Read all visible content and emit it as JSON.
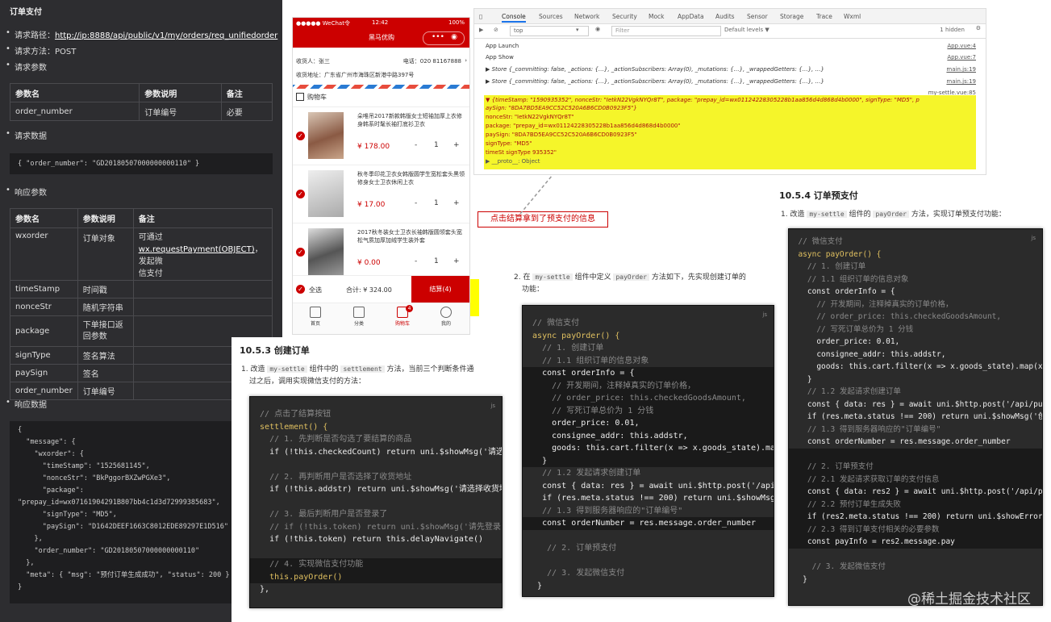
{
  "api": {
    "heading": "订单支付",
    "path_label": "请求路径：",
    "path_url": "http://ip:8888/api/public/v1/my/orders/req_unifiedorder",
    "method": "请求方法：POST",
    "params_label": "请求参数",
    "req_table": {
      "headers": [
        "参数名",
        "参数说明",
        "备注"
      ],
      "rows": [
        [
          "order_number",
          "订单编号",
          "必要"
        ]
      ]
    },
    "req_data_label": "请求数据",
    "req_data_code": "{ \"order_number\": \"GD20180507000000000110\" }",
    "resp_params_label": "响应参数",
    "resp_table": {
      "headers": [
        "参数名",
        "参数说明",
        "备注"
      ],
      "rows": [
        [
          "wxorder",
          "订单对象",
          "可通过"
        ],
        [
          "timeStamp",
          "时间戳",
          ""
        ],
        [
          "nonceStr",
          "随机字符串",
          ""
        ],
        [
          "package",
          "下单接口返",
          ""
        ],
        [
          "signType",
          "签名算法",
          ""
        ],
        [
          "paySign",
          "签名",
          ""
        ],
        [
          "order_number",
          "订单编号",
          ""
        ]
      ],
      "wx_note_link": "wx.requestPayment(OBJECT)",
      "wx_note_tail": "，发起微",
      "wx_note_line3": "信支付",
      "package_line2": "回参数"
    },
    "resp_data_label": "响应数据",
    "resp_code": [
      "{",
      "  \"message\": {",
      "    \"wxorder\": {",
      "      \"timeStamp\": \"1525681145\",",
      "      \"nonceStr\": \"BkPggorBXZwPGXe3\",",
      "      \"package\":",
      "\"prepay_id=wx07161904291B807bb4c1d3d72999385683\",",
      "      \"signType\": \"MD5\",",
      "      \"paySign\": \"D1642DEEF1663C8012EDE89297E1D516\"",
      "    },",
      "    \"order_number\": \"GD20180507000000000110\"",
      "  },",
      "  \"meta\": { \"msg\": \"预付订单生成成功\", \"status\": 200 }",
      "}"
    ]
  },
  "phone": {
    "status_left": "●●●●● WeChat令",
    "status_time": "12:42",
    "status_right": "100%",
    "nav_title": "黑马优购",
    "receiver": "收货人：张三",
    "phone_num": "电话：020 81167888",
    "address": "收货地址：广东省广州市海珠区新港中路397号",
    "cart_title": "购物车",
    "items": [
      {
        "title": "朵唯吊2017新款韩版女士短袖加厚上衣修身韩系时髦长袖打底衫卫衣",
        "price": "¥ 178.00",
        "qty": "1"
      },
      {
        "title": "秋冬季印花卫衣女韩版圆学生宽松套头黑领修身女士卫衣休闲上衣",
        "price": "¥ 17.00",
        "qty": "1"
      },
      {
        "title": "2017秋冬装女士卫衣长袖韩版圆领套头宽松气质加厚加绒学生装外套",
        "price": "¥ 0.00",
        "qty": "1"
      }
    ],
    "select_all": "全选",
    "total": "合计: ¥ 324.00",
    "settle": "结算(4)",
    "tabs": [
      "首页",
      "分类",
      "购物车",
      "我的"
    ],
    "cart_badge": "4"
  },
  "callout": "点击结算拿到了预支付的信息",
  "devtools": {
    "tabs": [
      "Console",
      "Sources",
      "Network",
      "Security",
      "Mock",
      "AppData",
      "Audits",
      "Sensor",
      "Storage",
      "Trace",
      "Wxml"
    ],
    "context": "top",
    "filter_placeholder": "Filter",
    "levels": "Default levels ▼",
    "hidden": "1 hidden",
    "logs": [
      {
        "text": "App Launch",
        "src": "App.vue:4"
      },
      {
        "text": "App Show",
        "src": "App.vue:7"
      },
      {
        "text": "▶ Store {_committing: false, _actions: {…}, _actionSubscribers: Array(0), _mutations: {…}, _wrappedGetters: {…}, …}",
        "src": "main.js:19"
      },
      {
        "text": "▶ Store {_committing: false, _actions: {…}, _actionSubscribers: Array(0), _mutations: {…}, _wrappedGetters: {…}, …}",
        "src": "main.js:19"
      }
    ],
    "settle_src": "my-settle.vue:85",
    "obj_lines": [
      "▼ {timeStamp: \"1590935352\", nonceStr: \"IetkN22VgkNYQr8T\", package: \"prepay_id=wx01124228305228b1aa856d4d868d4b0000\", signType: \"MD5\", p",
      "  aySign: \"8DA7BD5EA9CC52C520A6B6CD0B0923F5\"}",
      "    nonceStr: \"IetkN22VgkNYQr8T\"",
      "    package: \"prepay_id=wx01124228305228b1aa856d4d868d4b0000\"",
      "    paySign: \"8DA7BD5EA9CC52C520A6B6CD0B0923F5\"",
      "    signType: \"MD5\"",
      "    timeSt  signType  935352\"",
      "  ▶ __proto__: Object"
    ]
  },
  "sec_1053": {
    "title": "10.5.3 创建订单",
    "p1": "1. 改造",
    "c1": "my-settle",
    "p2": "组件中的",
    "c2": "settlement",
    "p3": "方法，当前三个判断条件通",
    "p4": "过之后，调用实现微信支付的方法："
  },
  "sec_mid": {
    "p1": "2. 在",
    "c1": "my-settle",
    "p2": "组件中定义",
    "c2": "payOrder",
    "p3": "方法如下，先实现创建订单的",
    "p4": "功能："
  },
  "sec_1054": {
    "title": "10.5.4 订单预支付",
    "p1": "1. 改造",
    "c1": "my-settle",
    "p2": "组件的",
    "c2": "payOrder",
    "p3": "方法，实现订单预支付功能："
  },
  "code_a": [
    {
      "t": "  // 点击了结算按钮",
      "c": "cm"
    },
    {
      "t": "  settlement() {",
      "c": "fn"
    },
    {
      "t": "    // 1. 先判断是否勾选了要结算的商品",
      "c": "cm"
    },
    {
      "t": "    if (!this.checkedCount) return uni.$showMsg('请选择要结算的商品！')",
      "c": "pl"
    },
    {
      "t": "",
      "c": "pl"
    },
    {
      "t": "    // 2. 再判断用户是否选择了收货地址",
      "c": "cm"
    },
    {
      "t": "    if (!this.addstr) return uni.$showMsg('请选择收货地址！')",
      "c": "pl"
    },
    {
      "t": "",
      "c": "pl"
    },
    {
      "t": "    // 3. 最后判断用户是否登录了",
      "c": "cm"
    },
    {
      "t": "    // if (!this.token) return uni.$showMsg('请先登录！')",
      "c": "cm"
    },
    {
      "t": "    if (!this.token) return this.delayNavigate()",
      "c": "pl"
    },
    {
      "t": "",
      "c": "pl"
    },
    {
      "t": "    // 4. 实现微信支付功能",
      "c": "cm hl"
    },
    {
      "t": "    this.payOrder()",
      "c": "fn hl"
    },
    {
      "t": "  },",
      "c": "pl"
    }
  ],
  "code_b": [
    {
      "t": "  // 微信支付",
      "c": "cm"
    },
    {
      "t": "  async payOrder() {",
      "c": "fn"
    },
    {
      "t": "    // 1. 创建订单",
      "c": "cm"
    },
    {
      "t": "    // 1.1 组织订单的信息对象",
      "c": "cm"
    },
    {
      "t": "    const orderInfo = {",
      "c": "pl hl"
    },
    {
      "t": "      // 开发期间，注释掉真实的订单价格，",
      "c": "cm hl"
    },
    {
      "t": "      // order_price: this.checkedGoodsAmount,",
      "c": "cm hl"
    },
    {
      "t": "      // 写死订单总价为 1 分钱",
      "c": "cm hl"
    },
    {
      "t": "      order_price: 0.01,",
      "c": "pl hl"
    },
    {
      "t": "      consignee_addr: this.addstr,",
      "c": "pl hl"
    },
    {
      "t": "      goods: this.cart.filter(x => x.goods_state).map(x => ({ goods_id",
      "c": "pl hl"
    },
    {
      "t": "    }",
      "c": "pl hl"
    },
    {
      "t": "    // 1.2 发起请求创建订单",
      "c": "cm"
    },
    {
      "t": "    const { data: res } = await uni.$http.post('/api/public/v1/my/or",
      "c": "pl"
    },
    {
      "t": "    if (res.meta.status !== 200) return uni.$showMsg('创建订单失败！')",
      "c": "pl"
    },
    {
      "t": "    // 1.3 得到服务器响应的\"订单编号\"",
      "c": "cm"
    },
    {
      "t": "    const orderNumber = res.message.order_number",
      "c": "pl hl"
    },
    {
      "t": "",
      "c": "pl"
    },
    {
      "t": "     // 2. 订单预支付",
      "c": "cm"
    },
    {
      "t": "",
      "c": "pl"
    },
    {
      "t": "     // 3. 发起微信支付",
      "c": "cm"
    },
    {
      "t": "   }",
      "c": "pl"
    }
  ],
  "code_c": [
    {
      "t": "  // 微信支付",
      "c": "cm"
    },
    {
      "t": "  async payOrder() {",
      "c": "fn"
    },
    {
      "t": "    // 1. 创建订单",
      "c": "cm"
    },
    {
      "t": "    // 1.1 组织订单的信息对象",
      "c": "cm"
    },
    {
      "t": "    const orderInfo = {",
      "c": "pl"
    },
    {
      "t": "      // 开发期间，注释掉真实的订单价格，",
      "c": "cm"
    },
    {
      "t": "      // order_price: this.checkedGoodsAmount,",
      "c": "cm"
    },
    {
      "t": "      // 写死订单总价为 1 分钱",
      "c": "cm"
    },
    {
      "t": "      order_price: 0.01,",
      "c": "pl"
    },
    {
      "t": "      consignee_addr: this.addstr,",
      "c": "pl"
    },
    {
      "t": "      goods: this.cart.filter(x => x.goods_state).map(x => ({ goods_",
      "c": "pl"
    },
    {
      "t": "    }",
      "c": "pl"
    },
    {
      "t": "    // 1.2 发起请求创建订单",
      "c": "cm"
    },
    {
      "t": "    const { data: res } = await uni.$http.post('/api/public/v1/my/",
      "c": "pl"
    },
    {
      "t": "    if (res.meta.status !== 200) return uni.$showMsg('创建订单失败！')",
      "c": "pl"
    },
    {
      "t": "    // 1.3 得到服务器响应的\"订单编号\"",
      "c": "cm"
    },
    {
      "t": "    const orderNumber = res.message.order_number",
      "c": "pl"
    },
    {
      "t": "",
      "c": "pl hl"
    },
    {
      "t": "    // 2. 订单预支付",
      "c": "cm hl"
    },
    {
      "t": "    // 2.1 发起请求获取订单的支付信息",
      "c": "cm hl"
    },
    {
      "t": "    const { data: res2 } = await uni.$http.post('/api/public/v1/my",
      "c": "pl hl"
    },
    {
      "t": "    // 2.2 预付订单生成失败",
      "c": "cm hl"
    },
    {
      "t": "    if (res2.meta.status !== 200) return uni.$showError('预付订单生",
      "c": "pl hl"
    },
    {
      "t": "    // 2.3 得到订单支付相关的必要参数",
      "c": "cm hl"
    },
    {
      "t": "    const payInfo = res2.message.pay",
      "c": "pl hl"
    },
    {
      "t": "",
      "c": "pl"
    },
    {
      "t": "     // 3. 发起微信支付",
      "c": "cm"
    },
    {
      "t": "   }",
      "c": "pl"
    }
  ],
  "watermark": "@稀土掘金技术社区"
}
